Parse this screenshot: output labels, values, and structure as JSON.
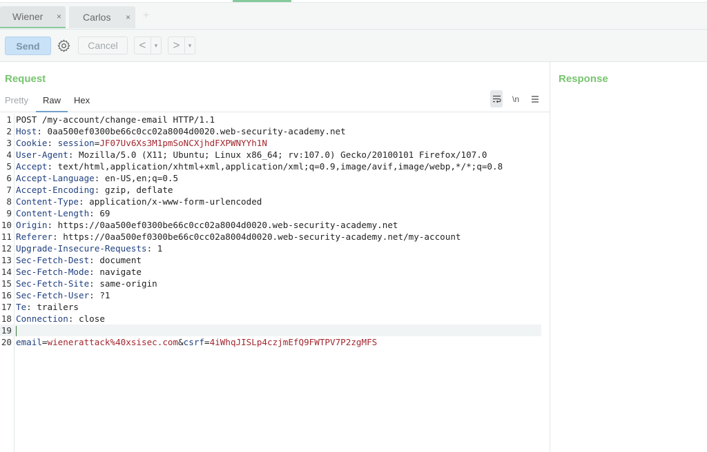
{
  "tabs": [
    {
      "label": "Wiener",
      "close": "×",
      "active": true
    },
    {
      "label": "Carlos",
      "close": "×",
      "active": false
    }
  ],
  "tab_add": "+",
  "toolbar": {
    "send_label": "Send",
    "cancel_label": "Cancel",
    "back_label": "<",
    "forward_label": ">",
    "drop_label": "▾"
  },
  "request": {
    "title": "Request",
    "subtabs": [
      "Pretty",
      "Raw",
      "Hex"
    ],
    "active_subtab": "Raw",
    "view_icons": {
      "wrap": "wrap-icon",
      "newline_label": "\\n",
      "menu": "menu-icon"
    },
    "lines": [
      {
        "n": "1",
        "text": "POST /my-account/change-email HTTP/1.1"
      },
      {
        "n": "2",
        "name": "Host",
        "value": " 0aa500ef0300be66c0cc02a8004d0020.web-security-academy.net"
      },
      {
        "n": "3",
        "name": "Cookie",
        "cookie_name": "session",
        "cookie_value": "JF07Uv6Xs3M1pmSoNCXjhdFXPWNYYh1N"
      },
      {
        "n": "4",
        "name": "User-Agent",
        "value": " Mozilla/5.0 (X11; Ubuntu; Linux x86_64; rv:107.0) Gecko/20100101 Firefox/107.0"
      },
      {
        "n": "5",
        "name": "Accept",
        "value": " text/html,application/xhtml+xml,application/xml;q=0.9,image/avif,image/webp,*/*;q=0.8"
      },
      {
        "n": "6",
        "name": "Accept-Language",
        "value": " en-US,en;q=0.5"
      },
      {
        "n": "7",
        "name": "Accept-Encoding",
        "value": " gzip, deflate"
      },
      {
        "n": "8",
        "name": "Content-Type",
        "value": " application/x-www-form-urlencoded"
      },
      {
        "n": "9",
        "name": "Content-Length",
        "value": " 69"
      },
      {
        "n": "10",
        "name": "Origin",
        "value": " https://0aa500ef0300be66c0cc02a8004d0020.web-security-academy.net"
      },
      {
        "n": "11",
        "name": "Referer",
        "value": " https://0aa500ef0300be66c0cc02a8004d0020.web-security-academy.net/my-account"
      },
      {
        "n": "12",
        "name": "Upgrade-Insecure-Requests",
        "value": " 1"
      },
      {
        "n": "13",
        "name": "Sec-Fetch-Dest",
        "value": " document"
      },
      {
        "n": "14",
        "name": "Sec-Fetch-Mode",
        "value": " navigate"
      },
      {
        "n": "15",
        "name": "Sec-Fetch-Site",
        "value": " same-origin"
      },
      {
        "n": "16",
        "name": "Sec-Fetch-User",
        "value": " ?1"
      },
      {
        "n": "17",
        "name": "Te",
        "value": " trailers"
      },
      {
        "n": "18",
        "name": "Connection",
        "value": " close"
      },
      {
        "n": "19",
        "text": ""
      },
      {
        "n": "20",
        "body": [
          {
            "k": "email",
            "v": "wienerattack%40xsisec.com"
          },
          {
            "k": "csrf",
            "v": "4iWhqJISLp4czjmEfQ9FWTPV7P2zgMFS"
          }
        ]
      }
    ]
  },
  "response": {
    "title": "Response"
  },
  "colors": {
    "accent_green": "#77c46e",
    "send_bg": "#c9e2f7",
    "header_name": "#1f3f7f",
    "value_red": "#a1262e"
  }
}
